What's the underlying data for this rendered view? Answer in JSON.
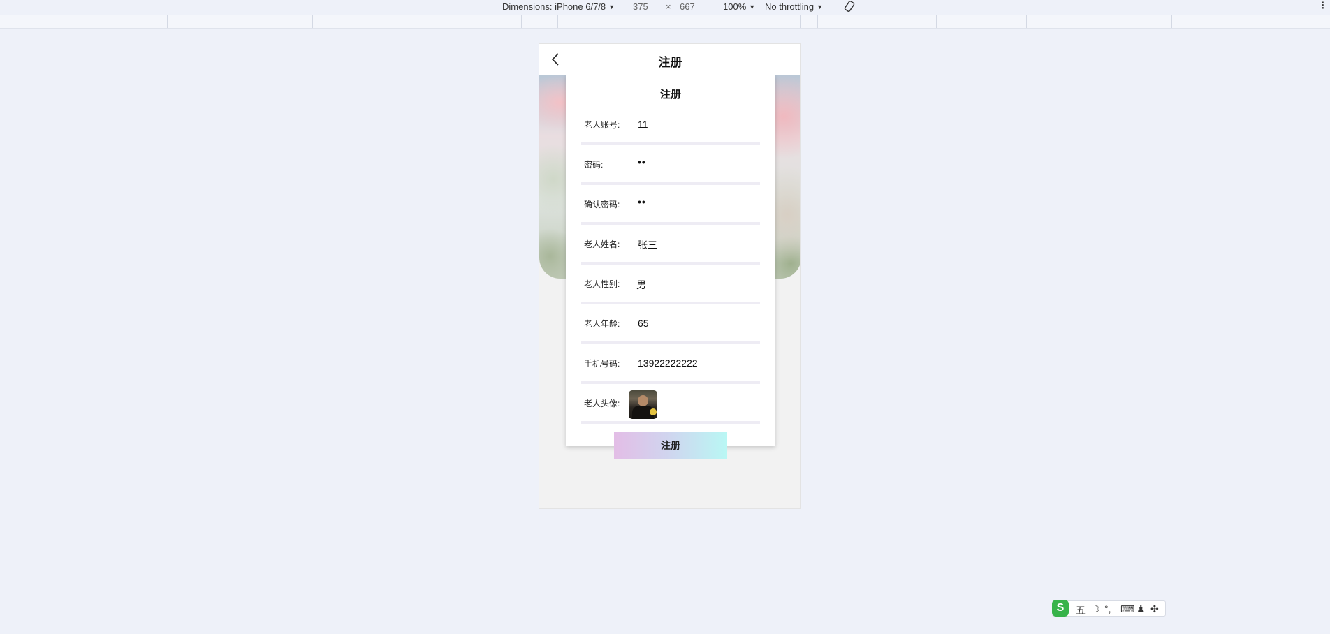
{
  "devtools": {
    "dimensions_label": "Dimensions: iPhone 6/7/8",
    "width": "375",
    "times": "×",
    "height": "667",
    "zoom": "100%",
    "throttling": "No throttling"
  },
  "navbar": {
    "title": "注册"
  },
  "form": {
    "title": "注册",
    "fields": [
      {
        "label": "老人账号:",
        "value": "11"
      },
      {
        "label": "密码:",
        "value": "••"
      },
      {
        "label": "确认密码:",
        "value": "••"
      },
      {
        "label": "老人姓名:",
        "value": "张三"
      },
      {
        "label": "老人性别:",
        "value": "男"
      },
      {
        "label": "老人年龄:",
        "value": "65"
      },
      {
        "label": "手机号码:",
        "value": "13922222222"
      },
      {
        "label": "老人头像:"
      }
    ],
    "submit_label": "注册"
  },
  "ime": {
    "logo": "S",
    "mode": "五",
    "items": [
      "☽",
      "°,",
      "⌨",
      "♟",
      "✣"
    ]
  }
}
